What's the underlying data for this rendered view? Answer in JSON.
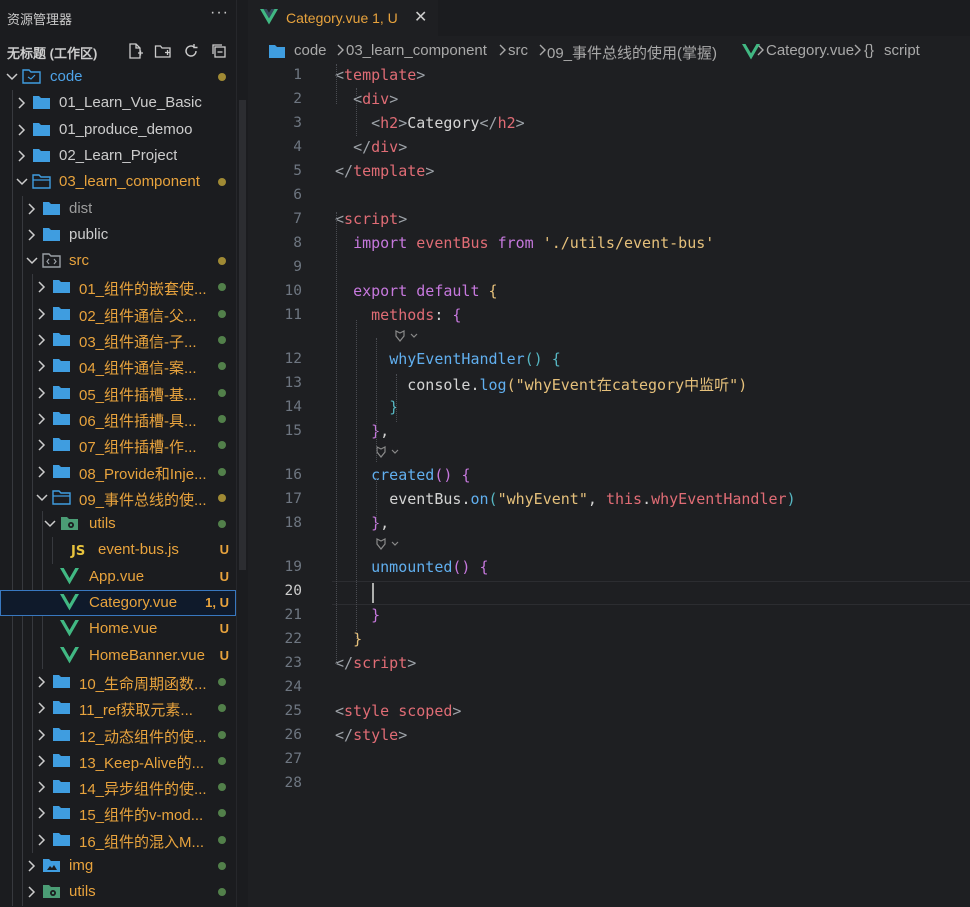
{
  "explorer": {
    "title": "资源管理器",
    "more": "···",
    "workspace": "无标题 (工作区)",
    "actions": [
      "new-file-icon",
      "new-folder-icon",
      "refresh-icon",
      "collapse-all-icon"
    ]
  },
  "tree": [
    {
      "label": "code",
      "depth": 0,
      "type": "root",
      "open": true,
      "color": "#4ea3e8",
      "status": "dot-yellow"
    },
    {
      "label": "01_Learn_Vue_Basic",
      "depth": 1,
      "type": "folder",
      "open": false,
      "color": "#cccccc"
    },
    {
      "label": "01_produce_demoo",
      "depth": 1,
      "type": "folder",
      "open": false,
      "color": "#cccccc"
    },
    {
      "label": "02_Learn_Project",
      "depth": 1,
      "type": "folder",
      "open": false,
      "color": "#cccccc"
    },
    {
      "label": "03_learn_component",
      "depth": 1,
      "type": "folder",
      "open": true,
      "color": "#e8a33d",
      "status": "dot-yellow"
    },
    {
      "label": "dist",
      "depth": 2,
      "type": "folder",
      "open": false,
      "color": "#9d9d9d"
    },
    {
      "label": "public",
      "depth": 2,
      "type": "folder",
      "open": false,
      "color": "#cccccc"
    },
    {
      "label": "src",
      "depth": 2,
      "type": "src",
      "open": true,
      "color": "#e8a33d",
      "status": "dot-yellow"
    },
    {
      "label": "01_组件的嵌套使...",
      "depth": 3,
      "type": "folder",
      "open": false,
      "color": "#e8a33d",
      "status": "dot-green"
    },
    {
      "label": "02_组件通信-父...",
      "depth": 3,
      "type": "folder",
      "open": false,
      "color": "#e8a33d",
      "status": "dot-green"
    },
    {
      "label": "03_组件通信-子...",
      "depth": 3,
      "type": "folder",
      "open": false,
      "color": "#e8a33d",
      "status": "dot-green"
    },
    {
      "label": "04_组件通信-案...",
      "depth": 3,
      "type": "folder",
      "open": false,
      "color": "#e8a33d",
      "status": "dot-green"
    },
    {
      "label": "05_组件插槽-基...",
      "depth": 3,
      "type": "folder",
      "open": false,
      "color": "#e8a33d",
      "status": "dot-green"
    },
    {
      "label": "06_组件插槽-具...",
      "depth": 3,
      "type": "folder",
      "open": false,
      "color": "#e8a33d",
      "status": "dot-green"
    },
    {
      "label": "07_组件插槽-作...",
      "depth": 3,
      "type": "folder",
      "open": false,
      "color": "#e8a33d",
      "status": "dot-green"
    },
    {
      "label": "08_Provide和Inje...",
      "depth": 3,
      "type": "folder",
      "open": false,
      "color": "#e8a33d",
      "status": "dot-green"
    },
    {
      "label": "09_事件总线的使...",
      "depth": 3,
      "type": "folder",
      "open": true,
      "color": "#e8a33d",
      "status": "dot-yellow"
    },
    {
      "label": "utils",
      "depth": 4,
      "type": "utils",
      "open": true,
      "color": "#e8a33d",
      "status": "dot-green"
    },
    {
      "label": "event-bus.js",
      "depth": 5,
      "type": "js",
      "color": "#e8a33d",
      "badge": "U"
    },
    {
      "label": "App.vue",
      "depth": 4,
      "type": "vue",
      "color": "#e8a33d",
      "badge": "U"
    },
    {
      "label": "Category.vue",
      "depth": 4,
      "type": "vue",
      "color": "#e8a33d",
      "badge": "1, U",
      "selected": true
    },
    {
      "label": "Home.vue",
      "depth": 4,
      "type": "vue",
      "color": "#e8a33d",
      "badge": "U"
    },
    {
      "label": "HomeBanner.vue",
      "depth": 4,
      "type": "vue",
      "color": "#e8a33d",
      "badge": "U"
    },
    {
      "label": "10_生命周期函数...",
      "depth": 3,
      "type": "folder",
      "open": false,
      "color": "#e8a33d",
      "status": "dot-green"
    },
    {
      "label": "11_ref获取元素...",
      "depth": 3,
      "type": "folder",
      "open": false,
      "color": "#e8a33d",
      "status": "dot-green"
    },
    {
      "label": "12_动态组件的使...",
      "depth": 3,
      "type": "folder",
      "open": false,
      "color": "#e8a33d",
      "status": "dot-green"
    },
    {
      "label": "13_Keep-Alive的...",
      "depth": 3,
      "type": "folder",
      "open": false,
      "color": "#e8a33d",
      "status": "dot-green"
    },
    {
      "label": "14_异步组件的使...",
      "depth": 3,
      "type": "folder",
      "open": false,
      "color": "#e8a33d",
      "status": "dot-green"
    },
    {
      "label": "15_组件的v-mod...",
      "depth": 3,
      "type": "folder",
      "open": false,
      "color": "#e8a33d",
      "status": "dot-green"
    },
    {
      "label": "16_组件的混入M...",
      "depth": 3,
      "type": "folder",
      "open": false,
      "color": "#e8a33d",
      "status": "dot-green"
    },
    {
      "label": "img",
      "depth": 2,
      "type": "img",
      "open": false,
      "color": "#e8a33d",
      "status": "dot-green"
    },
    {
      "label": "utils",
      "depth": 2,
      "type": "utils",
      "open": false,
      "color": "#e8a33d",
      "status": "dot-green"
    }
  ],
  "tab": {
    "label": "Category.vue 1, U",
    "close": "✕",
    "icon": "vue-icon"
  },
  "breadcrumb": [
    "code",
    "03_learn_component",
    "src",
    "09_事件总线的使用(掌握)",
    "Category.vue",
    "script"
  ],
  "breadcrumb_icons": {
    "vue": "vue-icon",
    "script": "braces-icon"
  },
  "editor": {
    "active_line": 20,
    "lines": [
      {
        "n": "1",
        "tokens": [
          [
            "<",
            "t-br"
          ],
          [
            "template",
            "t-tag"
          ],
          [
            ">",
            "t-br"
          ]
        ]
      },
      {
        "n": "2",
        "tokens": [
          [
            "  ",
            ""
          ],
          [
            "<",
            "t-br"
          ],
          [
            "div",
            "t-tag"
          ],
          [
            ">",
            "t-br"
          ]
        ]
      },
      {
        "n": "3",
        "tokens": [
          [
            "    ",
            ""
          ],
          [
            "<",
            "t-br"
          ],
          [
            "h2",
            "t-tag"
          ],
          [
            ">",
            "t-br"
          ],
          [
            "Category",
            "t-txt"
          ],
          [
            "</",
            "t-br"
          ],
          [
            "h2",
            "t-tag"
          ],
          [
            ">",
            "t-br"
          ]
        ]
      },
      {
        "n": "4",
        "tokens": [
          [
            "  ",
            ""
          ],
          [
            "</",
            "t-br"
          ],
          [
            "div",
            "t-tag"
          ],
          [
            ">",
            "t-br"
          ]
        ]
      },
      {
        "n": "5",
        "tokens": [
          [
            "</",
            "t-br"
          ],
          [
            "template",
            "t-tag"
          ],
          [
            ">",
            "t-br"
          ]
        ]
      },
      {
        "n": "6",
        "tokens": []
      },
      {
        "n": "7",
        "tokens": [
          [
            "<",
            "t-br"
          ],
          [
            "script",
            "t-tag"
          ],
          [
            ">",
            "t-br"
          ]
        ]
      },
      {
        "n": "8",
        "tokens": [
          [
            "  ",
            ""
          ],
          [
            "import",
            "t-kw"
          ],
          [
            " ",
            ""
          ],
          [
            "eventBus",
            "t-var"
          ],
          [
            " ",
            ""
          ],
          [
            "from",
            "t-kw"
          ],
          [
            " ",
            ""
          ],
          [
            "'./utils/event-bus'",
            "t-str"
          ]
        ]
      },
      {
        "n": "9",
        "tokens": []
      },
      {
        "n": "10",
        "tokens": [
          [
            "  ",
            ""
          ],
          [
            "export",
            "t-kw"
          ],
          [
            " ",
            ""
          ],
          [
            "default",
            "t-kw"
          ],
          [
            " ",
            ""
          ],
          [
            "{",
            "t-y1"
          ]
        ]
      },
      {
        "n": "11",
        "tokens": [
          [
            "    ",
            ""
          ],
          [
            "methods",
            "t-var"
          ],
          [
            ": ",
            "t-txt"
          ],
          [
            "{",
            "t-p1"
          ]
        ]
      },
      {
        "n": "",
        "lens": true
      },
      {
        "n": "12",
        "tokens": [
          [
            "      ",
            ""
          ],
          [
            "whyEventHandler",
            "t-fn"
          ],
          [
            "()",
            "t-b1"
          ],
          [
            " ",
            ""
          ],
          [
            "{",
            "t-b1"
          ]
        ]
      },
      {
        "n": "13",
        "tokens": [
          [
            "        ",
            ""
          ],
          [
            "console",
            "t-txt"
          ],
          [
            ".",
            "t-txt"
          ],
          [
            "log",
            "t-fn"
          ],
          [
            "(",
            "t-y1"
          ],
          [
            "\"whyEvent在category中监听\"",
            "t-str"
          ],
          [
            ")",
            "t-y1"
          ]
        ]
      },
      {
        "n": "14",
        "tokens": [
          [
            "      ",
            ""
          ],
          [
            "}",
            "t-b1"
          ]
        ]
      },
      {
        "n": "15",
        "tokens": [
          [
            "    ",
            ""
          ],
          [
            "}",
            "t-p1"
          ],
          [
            ",",
            "t-txt"
          ]
        ]
      },
      {
        "n": "",
        "lens": true
      },
      {
        "n": "16",
        "tokens": [
          [
            "    ",
            ""
          ],
          [
            "created",
            "t-fn"
          ],
          [
            "()",
            "t-p1"
          ],
          [
            " ",
            ""
          ],
          [
            "{",
            "t-p1"
          ]
        ]
      },
      {
        "n": "17",
        "tokens": [
          [
            "      ",
            ""
          ],
          [
            "eventBus",
            "t-txt"
          ],
          [
            ".",
            "t-txt"
          ],
          [
            "on",
            "t-fn"
          ],
          [
            "(",
            "t-b1"
          ],
          [
            "\"whyEvent\"",
            "t-str"
          ],
          [
            ", ",
            "t-txt"
          ],
          [
            "this",
            "t-var"
          ],
          [
            ".",
            "t-txt"
          ],
          [
            "whyEventHandler",
            "t-var"
          ],
          [
            ")",
            "t-b1"
          ]
        ]
      },
      {
        "n": "18",
        "tokens": [
          [
            "    ",
            ""
          ],
          [
            "}",
            "t-p1"
          ],
          [
            ",",
            "t-txt"
          ]
        ]
      },
      {
        "n": "",
        "lens": true
      },
      {
        "n": "19",
        "tokens": [
          [
            "    ",
            ""
          ],
          [
            "unmounted",
            "t-fn"
          ],
          [
            "()",
            "t-p1"
          ],
          [
            " ",
            ""
          ],
          [
            "{",
            "t-p1"
          ]
        ]
      },
      {
        "n": "20",
        "tokens": []
      },
      {
        "n": "21",
        "tokens": [
          [
            "    ",
            ""
          ],
          [
            "}",
            "t-p1"
          ]
        ]
      },
      {
        "n": "22",
        "tokens": [
          [
            "  ",
            ""
          ],
          [
            "}",
            "t-y1"
          ]
        ]
      },
      {
        "n": "23",
        "tokens": [
          [
            "</",
            "t-br"
          ],
          [
            "script",
            "t-tag"
          ],
          [
            ">",
            "t-br"
          ]
        ]
      },
      {
        "n": "24",
        "tokens": []
      },
      {
        "n": "25",
        "tokens": [
          [
            "<",
            "t-br"
          ],
          [
            "style",
            "t-tag"
          ],
          [
            " ",
            ""
          ],
          [
            "scoped",
            "t-var"
          ],
          [
            ">",
            "t-br"
          ]
        ]
      },
      {
        "n": "26",
        "tokens": [
          [
            "</",
            "t-br"
          ],
          [
            "style",
            "t-tag"
          ],
          [
            ">",
            "t-br"
          ]
        ]
      },
      {
        "n": "27",
        "tokens": []
      },
      {
        "n": "28",
        "tokens": []
      }
    ]
  },
  "colors": {
    "accent": "#4ea3e8",
    "modified": "#e8a33d",
    "untracked_dot": "#7fb36b",
    "vue_green": "#41b883",
    "js_yellow": "#e8c33d"
  }
}
